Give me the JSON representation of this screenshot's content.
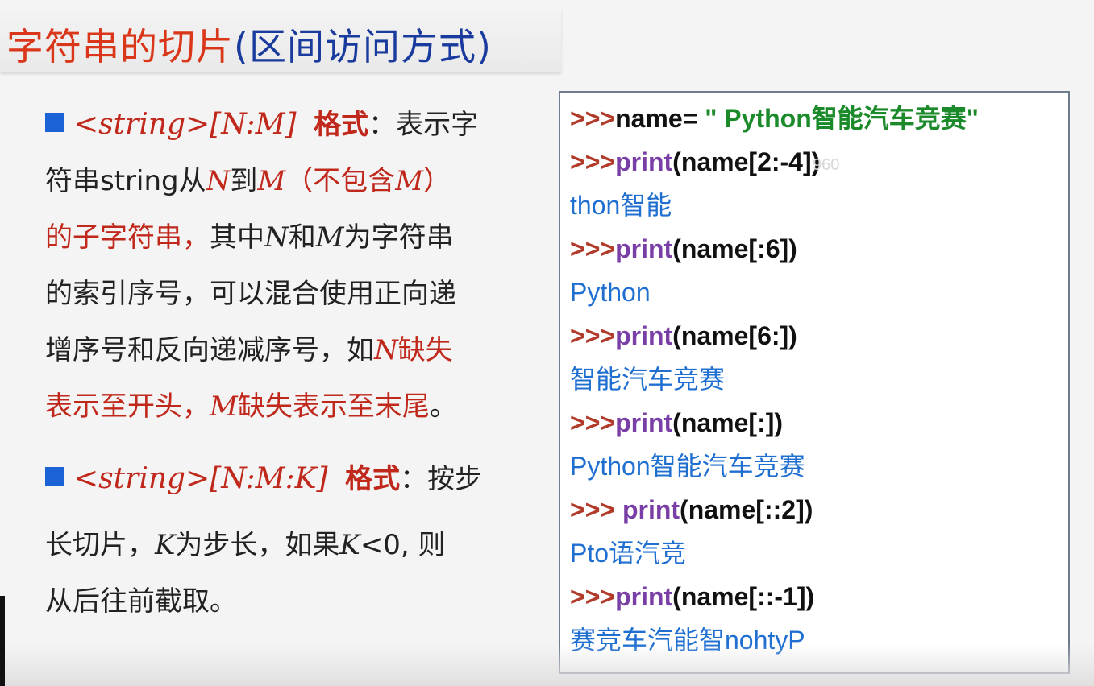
{
  "slide": {
    "title_red": "字符串的切片",
    "title_blue": "(区间访问方式)"
  },
  "left": {
    "b1_format": "<string>[N:M]",
    "b1_label": "格式",
    "b1_colon": "：",
    "b1_t1": "表示字",
    "l2_a": "符串string从",
    "l2_N": "N",
    "l2_b": "到",
    "l2_M": "M",
    "l2_c": "（不包含",
    "l2_M2": "M",
    "l2_d": "）",
    "l3_red": "的子字符串，",
    "l3_a": "其中",
    "l3_N": "N",
    "l3_b": "和",
    "l3_M": "M",
    "l3_c": "为字符串",
    "l4": "的索引序号，可以混合使用正向递",
    "l5_a": "增序号和反向递减序号，如",
    "l5_N": "N",
    "l5_red": "缺失",
    "l6_red_a": "表示至开头，",
    "l6_M": "M",
    "l6_red_b": "缺失表示至末尾",
    "l6_end": "。",
    "b2_format": "<string>[N:M:K]",
    "b2_label": "格式",
    "b2_colon": "：",
    "b2_t1": "按步",
    "l8_a": "长切片，",
    "l8_K": "K",
    "l8_b": "为步长，如果",
    "l8_K2": "K",
    "l8_c": "<0, 则",
    "l9": "从后往前截取。"
  },
  "code": {
    "prompt": ">>>",
    "prompt_sp": ">>> ",
    "c1_a": "name= ",
    "c1_str": "\" Python智能汽车竞赛\"",
    "kw": "print",
    "c2": "(name[2:-4])",
    "o2": "thon智能",
    "c3": "(name[:6])",
    "o3": "Python",
    "c4": "(name[6:])",
    "o4": "智能汽车竞赛",
    "c5": "(name[:])",
    "o5": "Python智能汽车竞赛",
    "c6": "(name[::2])",
    "o6": "Pto语汽竞",
    "c7": "(name[::-1])",
    "o7": "赛竞车汽能智nohtyP",
    "watermark": "960"
  }
}
